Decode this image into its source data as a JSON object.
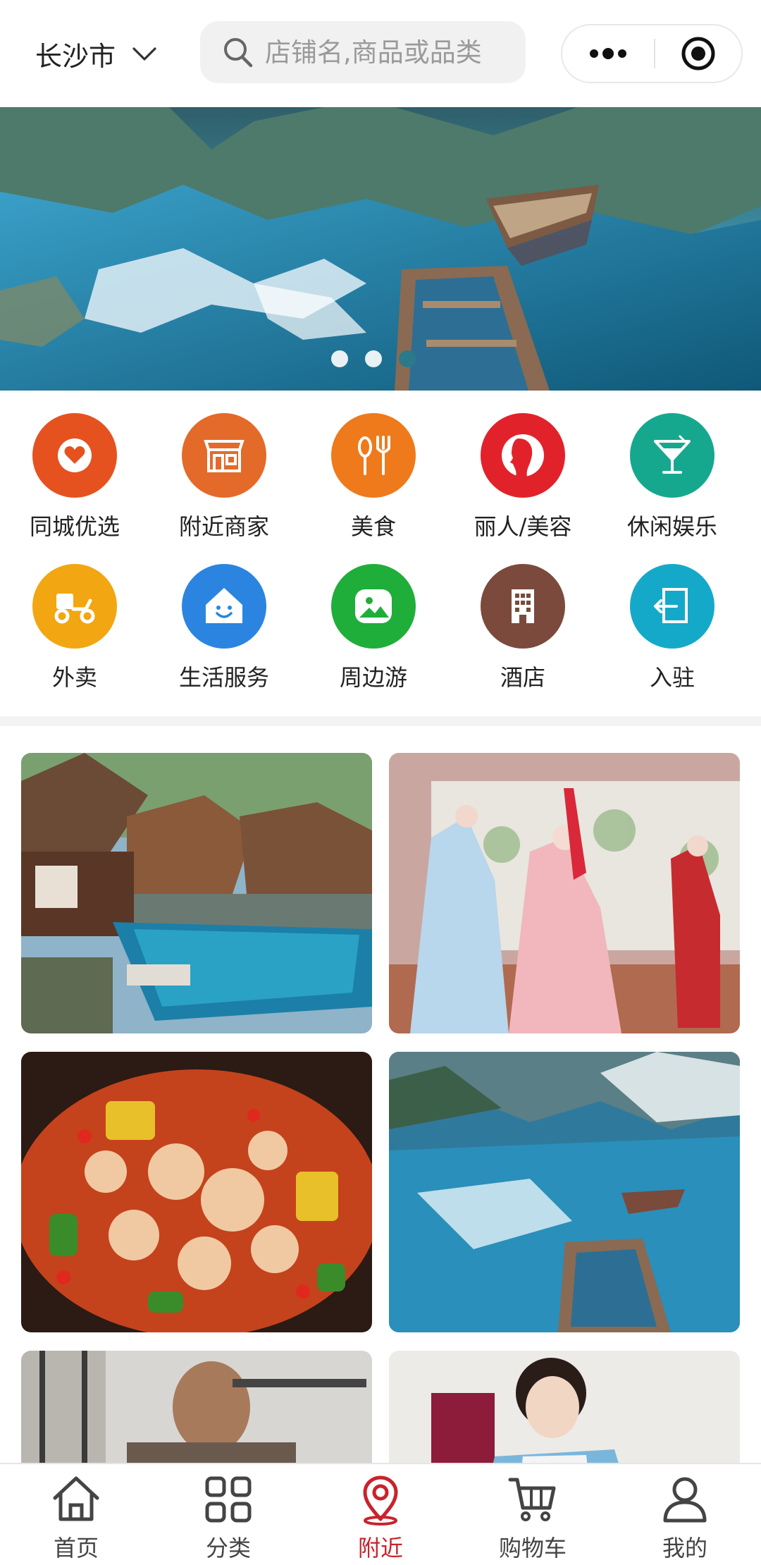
{
  "header": {
    "city": "长沙市",
    "search_placeholder": "店铺名,商品或品类"
  },
  "banner": {
    "dots": 3,
    "active_index": 2
  },
  "categories": [
    {
      "label": "同城优选",
      "icon": "heart-icon",
      "color": "#e6521f"
    },
    {
      "label": "附近商家",
      "icon": "storefront-icon",
      "color": "#e46a2a"
    },
    {
      "label": "美食",
      "icon": "utensils-icon",
      "color": "#ee7a1c"
    },
    {
      "label": "丽人/美容",
      "icon": "woman-profile-icon",
      "color": "#e2222a"
    },
    {
      "label": "休闲娱乐",
      "icon": "cocktail-icon",
      "color": "#16a88f"
    },
    {
      "label": "外卖",
      "icon": "scooter-icon",
      "color": "#f2a612"
    },
    {
      "label": "生活服务",
      "icon": "house-smile-icon",
      "color": "#2b85e0"
    },
    {
      "label": "周边游",
      "icon": "landscape-icon",
      "color": "#1fae3a"
    },
    {
      "label": "酒店",
      "icon": "building-icon",
      "color": "#7b4a3c"
    },
    {
      "label": "入驻",
      "icon": "entry-icon",
      "color": "#15a9c9"
    }
  ],
  "cards": [
    {
      "name": "resort-pool-card"
    },
    {
      "name": "dance-class-card"
    },
    {
      "name": "food-dish-card"
    },
    {
      "name": "lake-boats-card"
    },
    {
      "name": "gym-card"
    },
    {
      "name": "cleaning-service-card"
    }
  ],
  "tabbar": {
    "items": [
      {
        "label": "首页",
        "icon": "home-icon",
        "active": false
      },
      {
        "label": "分类",
        "icon": "grid-icon",
        "active": false
      },
      {
        "label": "附近",
        "icon": "location-pin-icon",
        "active": true
      },
      {
        "label": "购物车",
        "icon": "cart-icon",
        "active": false
      },
      {
        "label": "我的",
        "icon": "user-icon",
        "active": false
      }
    ],
    "active_color": "#c8232c"
  }
}
